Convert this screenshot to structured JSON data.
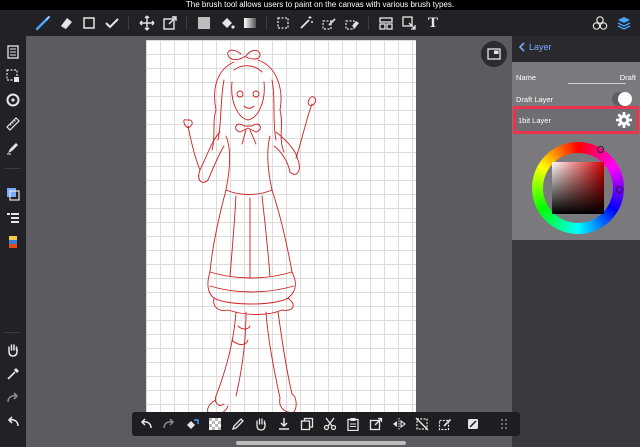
{
  "caption": "The brush tool allows users to paint on the canvas with various brush types.",
  "top_toolbar": {
    "tools": [
      "brush-icon",
      "eraser-icon",
      "rectangle-icon",
      "check-icon",
      "move-icon",
      "transform-icon",
      "fill-color-icon",
      "bucket-icon",
      "gradient-icon",
      "select-rect-icon",
      "magic-wand-icon",
      "select-pen-icon",
      "select-eraser-icon",
      "panel-icon",
      "auto-select-icon",
      "text-icon",
      "materials-icon",
      "layers-icon"
    ],
    "text_tool_label": "T"
  },
  "left_toolbar": {
    "tools": [
      "pages-icon",
      "selection-icon",
      "rotate-icon",
      "ruler-icon",
      "fill-tool-icon",
      "layer-stack-icon",
      "list-icon",
      "color-swatch-icon",
      "hand-icon",
      "eyedropper-icon",
      "redo-icon",
      "undo-icon"
    ]
  },
  "layer_panel": {
    "back_label": "Layer",
    "name_label": "Name",
    "name_value": "Draft",
    "draft_layer_label": "Draft Layer",
    "draft_layer_on": true,
    "onebit_layer_label": "1bit Layer",
    "highlight_color": "#e8344e",
    "current_color": "#d40000"
  },
  "bottom_toolbar": {
    "tools": [
      "undo-icon",
      "redo-icon",
      "transform-fill-icon",
      "checker-icon",
      "pen-icon",
      "hand-icon",
      "download-icon",
      "copy-icon",
      "cut-icon",
      "paste-icon",
      "transform-icon",
      "flip-icon",
      "deselect-icon",
      "edit-icon",
      "guide-icon",
      "grip-icon"
    ]
  },
  "colors": {
    "accent": "#7aa9ff",
    "drawing_line": "#cc2020"
  }
}
